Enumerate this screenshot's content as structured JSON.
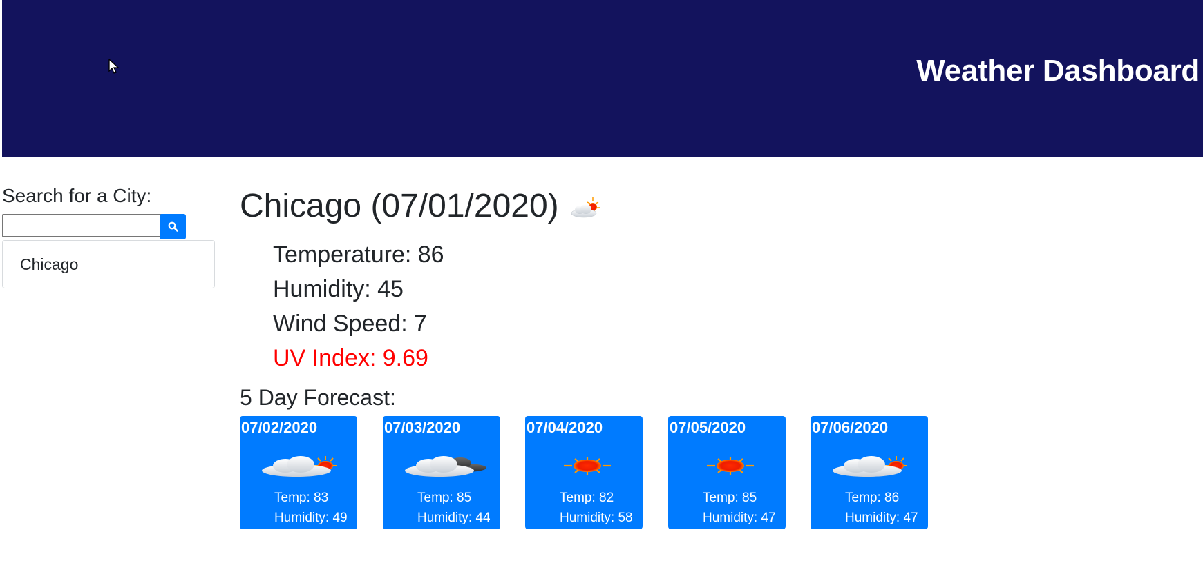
{
  "header": {
    "title": "Weather Dashboard",
    "background_color": "#13135d"
  },
  "sidebar": {
    "search_label": "Search for a City:",
    "search_input_value": "",
    "search_button_icon": "search-icon",
    "history": [
      {
        "label": "Chicago"
      }
    ]
  },
  "current": {
    "title": "Chicago (07/01/2020)",
    "icon": "partly-cloudy-icon",
    "temperature": "Temperature: 86",
    "humidity": "Humidity: 45",
    "wind_speed": "Wind Speed: 7",
    "uv_index": "UV Index: 9.69",
    "uv_color": "#ff0000"
  },
  "forecast": {
    "title": "5 Day Forecast:",
    "card_color": "#007bff",
    "days": [
      {
        "date": "07/02/2020",
        "icon": "cloud-sun-icon",
        "temp": "Temp: 83",
        "humidity": "Humidity: 49"
      },
      {
        "date": "07/03/2020",
        "icon": "clouds-icon",
        "temp": "Temp: 85",
        "humidity": "Humidity: 44"
      },
      {
        "date": "07/04/2020",
        "icon": "sun-icon",
        "temp": "Temp: 82",
        "humidity": "Humidity: 58"
      },
      {
        "date": "07/05/2020",
        "icon": "sun-icon",
        "temp": "Temp: 85",
        "humidity": "Humidity: 47"
      },
      {
        "date": "07/06/2020",
        "icon": "cloud-sun-icon",
        "temp": "Temp: 86",
        "humidity": "Humidity: 47"
      }
    ]
  }
}
